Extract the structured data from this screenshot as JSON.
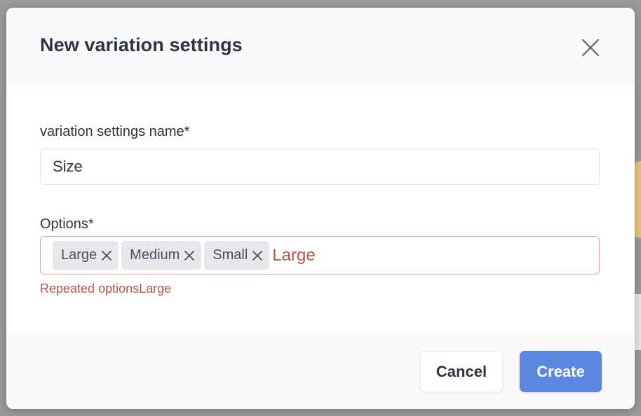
{
  "dialog": {
    "title": "New variation settings",
    "close_icon": "close-icon"
  },
  "form": {
    "name_label": "variation settings name*",
    "name_value": "Size",
    "options_label": "Options*",
    "options": [
      {
        "label": "Large",
        "remove_icon": "x-icon"
      },
      {
        "label": "Medium",
        "remove_icon": "x-icon"
      },
      {
        "label": "Small",
        "remove_icon": "x-icon"
      }
    ],
    "options_typing": "Large",
    "error": "Repeated optionsLarge"
  },
  "footer": {
    "cancel_label": "Cancel",
    "create_label": "Create"
  },
  "colors": {
    "primary": "#5b87e0",
    "error": "#b0594a",
    "error_border": "#e3a59b",
    "text": "#2d3340",
    "tag_bg": "#e6e8ec"
  }
}
